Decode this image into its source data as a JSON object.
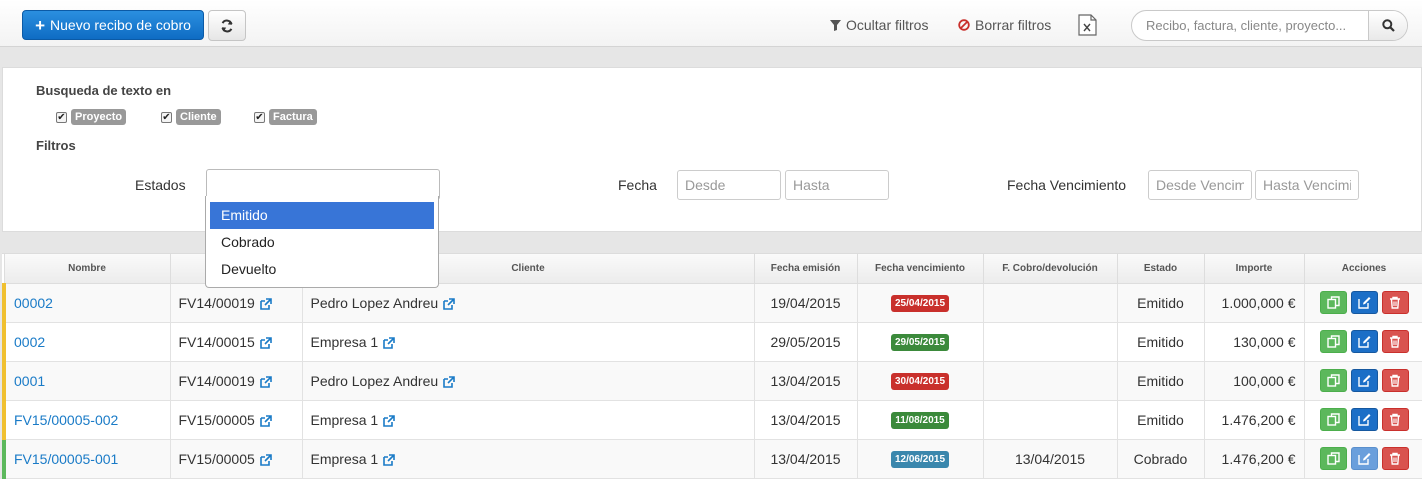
{
  "toolbar": {
    "new_button": "Nuevo recibo de cobro",
    "hide_filters": "Ocultar filtros",
    "clear_filters": "Borrar filtros",
    "search_placeholder": "Recibo, factura, cliente, proyecto..."
  },
  "filters": {
    "text_search_heading": "Busqueda de texto en",
    "checkboxes": [
      {
        "label": "Proyecto",
        "checked": true
      },
      {
        "label": "Cliente",
        "checked": true
      },
      {
        "label": "Factura",
        "checked": true
      }
    ],
    "filters_heading": "Filtros",
    "estados_label": "Estados",
    "estados_options": [
      "Emitido",
      "Cobrado",
      "Devuelto"
    ],
    "estados_highlighted": "Emitido",
    "fecha_label": "Fecha",
    "fecha_desde_placeholder": "Desde",
    "fecha_hasta_placeholder": "Hasta",
    "fecha_venc_label": "Fecha Vencimiento",
    "venc_desde_placeholder": "Desde Vencim",
    "venc_hasta_placeholder": "Hasta Vencimi"
  },
  "table": {
    "columns": [
      "Nombre",
      "",
      "Cliente",
      "Fecha emisión",
      "Fecha vencimiento",
      "F. Cobro/devolución",
      "Estado",
      "Importe",
      "Acciones"
    ],
    "rows": [
      {
        "nombre": "00002",
        "factura": "FV14/00019",
        "cliente": "Pedro Lopez Andreu",
        "emision": "19/04/2015",
        "vencimiento": "25/04/2015",
        "venc_color": "#c9302c",
        "cobro": "",
        "estado": "Emitido",
        "importe": "1.000,000 €",
        "mark": "yellow"
      },
      {
        "nombre": "0002",
        "factura": "FV14/00015",
        "cliente": "Empresa 1",
        "emision": "29/05/2015",
        "vencimiento": "29/05/2015",
        "venc_color": "#3b8a3b",
        "cobro": "",
        "estado": "Emitido",
        "importe": "130,000 €",
        "mark": "yellow"
      },
      {
        "nombre": "0001",
        "factura": "FV14/00019",
        "cliente": "Pedro Lopez Andreu",
        "emision": "13/04/2015",
        "vencimiento": "30/04/2015",
        "venc_color": "#c9302c",
        "cobro": "",
        "estado": "Emitido",
        "importe": "100,000 €",
        "mark": "yellow"
      },
      {
        "nombre": "FV15/00005-002",
        "factura": "FV15/00005",
        "cliente": "Empresa 1",
        "emision": "13/04/2015",
        "vencimiento": "11/08/2015",
        "venc_color": "#3b8a3b",
        "cobro": "",
        "estado": "Emitido",
        "importe": "1.476,200 €",
        "mark": "yellow"
      },
      {
        "nombre": "FV15/00005-001",
        "factura": "FV15/00005",
        "cliente": "Empresa 1",
        "emision": "13/04/2015",
        "vencimiento": "12/06/2015",
        "venc_color": "#3a87ad",
        "cobro": "13/04/2015",
        "estado": "Cobrado",
        "importe": "1.476,200 €",
        "mark": "green"
      }
    ]
  }
}
